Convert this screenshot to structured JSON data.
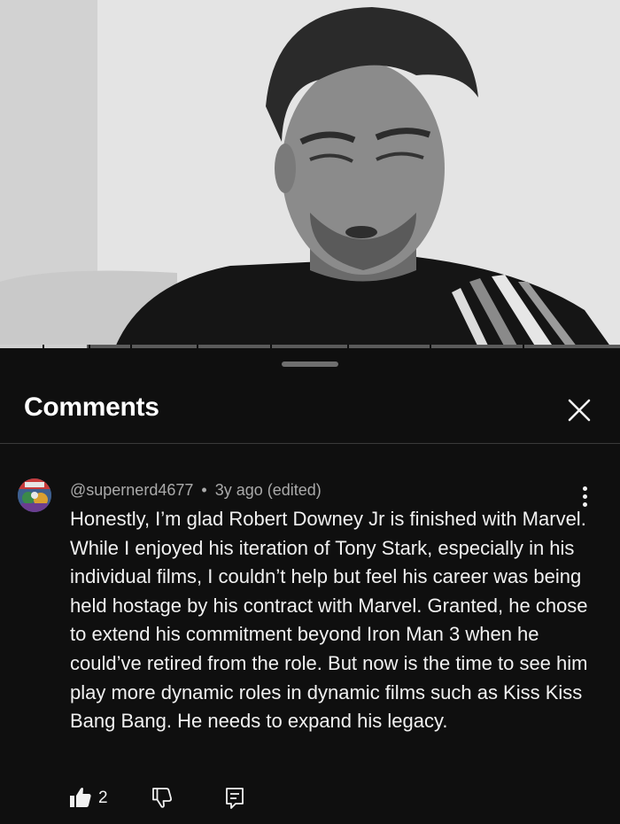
{
  "video": {
    "description_icon": "video-thumbnail",
    "progress_percent": 14
  },
  "sheet": {
    "title": "Comments",
    "close_icon": "close-icon"
  },
  "comment": {
    "author": "@supernerd4677",
    "separator": "•",
    "time": "3y ago (edited)",
    "text": "Honestly, I’m glad Robert Downey Jr is finished with Marvel. While I enjoyed his iteration of Tony Stark, especially in his individual films, I couldn’t help but feel his career was being held hostage by his contract with Marvel. Granted, he chose to extend his commitment beyond Iron Man 3 when he could’ve retired from the role. But now is the time to see him play more dynamic roles in dynamic films such as Kiss Kiss Bang Bang. He needs to expand his legacy.",
    "like_count": "2",
    "icons": [
      "thumbs-up-icon",
      "thumbs-down-icon",
      "reply-icon",
      "more-vert-icon"
    ]
  },
  "colors": {
    "background": "#0f0f0f",
    "text": "#f1f1f1",
    "secondary_text": "#aaaaaa"
  }
}
